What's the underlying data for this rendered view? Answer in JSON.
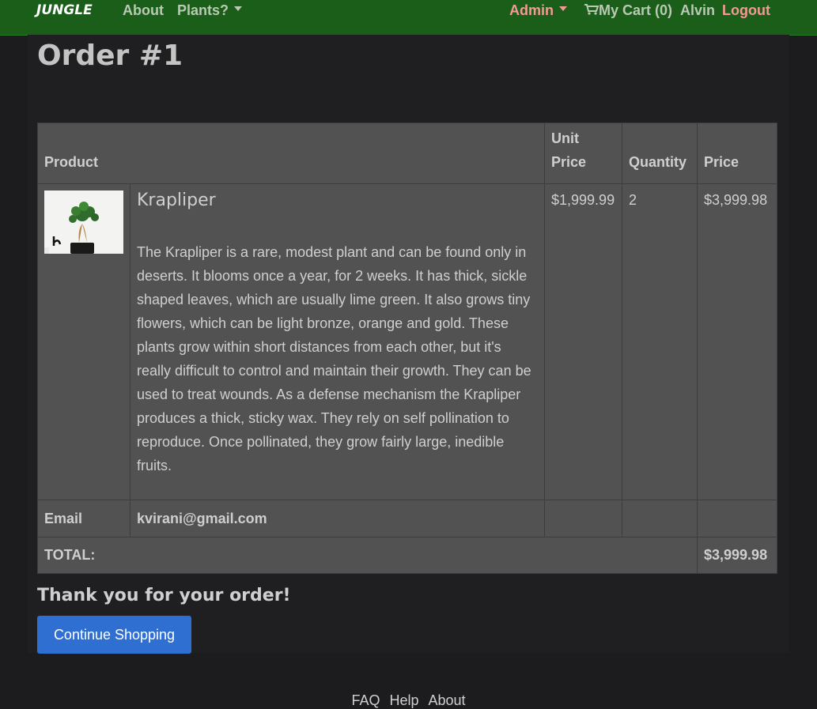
{
  "navbar": {
    "brand": "JUNGLE",
    "about": "About",
    "plants": "Plants?",
    "admin": "Admin",
    "cart": "My Cart (0)",
    "user": "Alvin",
    "logout": "Logout"
  },
  "page": {
    "title": "Order #1"
  },
  "table": {
    "headers": {
      "product": "Product",
      "unit_price": "Unit Price",
      "quantity": "Quantity",
      "price": "Price"
    },
    "items": [
      {
        "name": "Krapliper",
        "description": "The Krapliper is a rare, modest plant and can be found only in deserts. It blooms once a year, for 2 weeks. It has thick, sickle shaped leaves, which are usually lime green. It also grows tiny flowers, which can be light bronze, orange and gold. These plants grow within short distances from each other, but it's really difficult to control and maintain their growth. They can be used to treat wounds. As a defense mechanism the Krapliper produces a thick, sticky wax. They rely on self pollination to reproduce. Once pollinated, they grow fairly large, inedible fruits.",
        "unit_price": "$1,999.99",
        "quantity": "2",
        "price": "$3,999.98"
      }
    ],
    "email_label": "Email",
    "email_value": "kvirani@gmail.com",
    "total_label": "TOTAL:",
    "total_value": "$3,999.98"
  },
  "thanks": "Thank you for your order!",
  "continue_button": "Continue Shopping",
  "footer": {
    "links": [
      "FAQ",
      "Help",
      "About"
    ]
  },
  "colors": {
    "navbar": "#1a5e1a",
    "accent_pink": "#f49a96",
    "button_blue": "#2f6fd1",
    "table_bg": "#525252"
  }
}
